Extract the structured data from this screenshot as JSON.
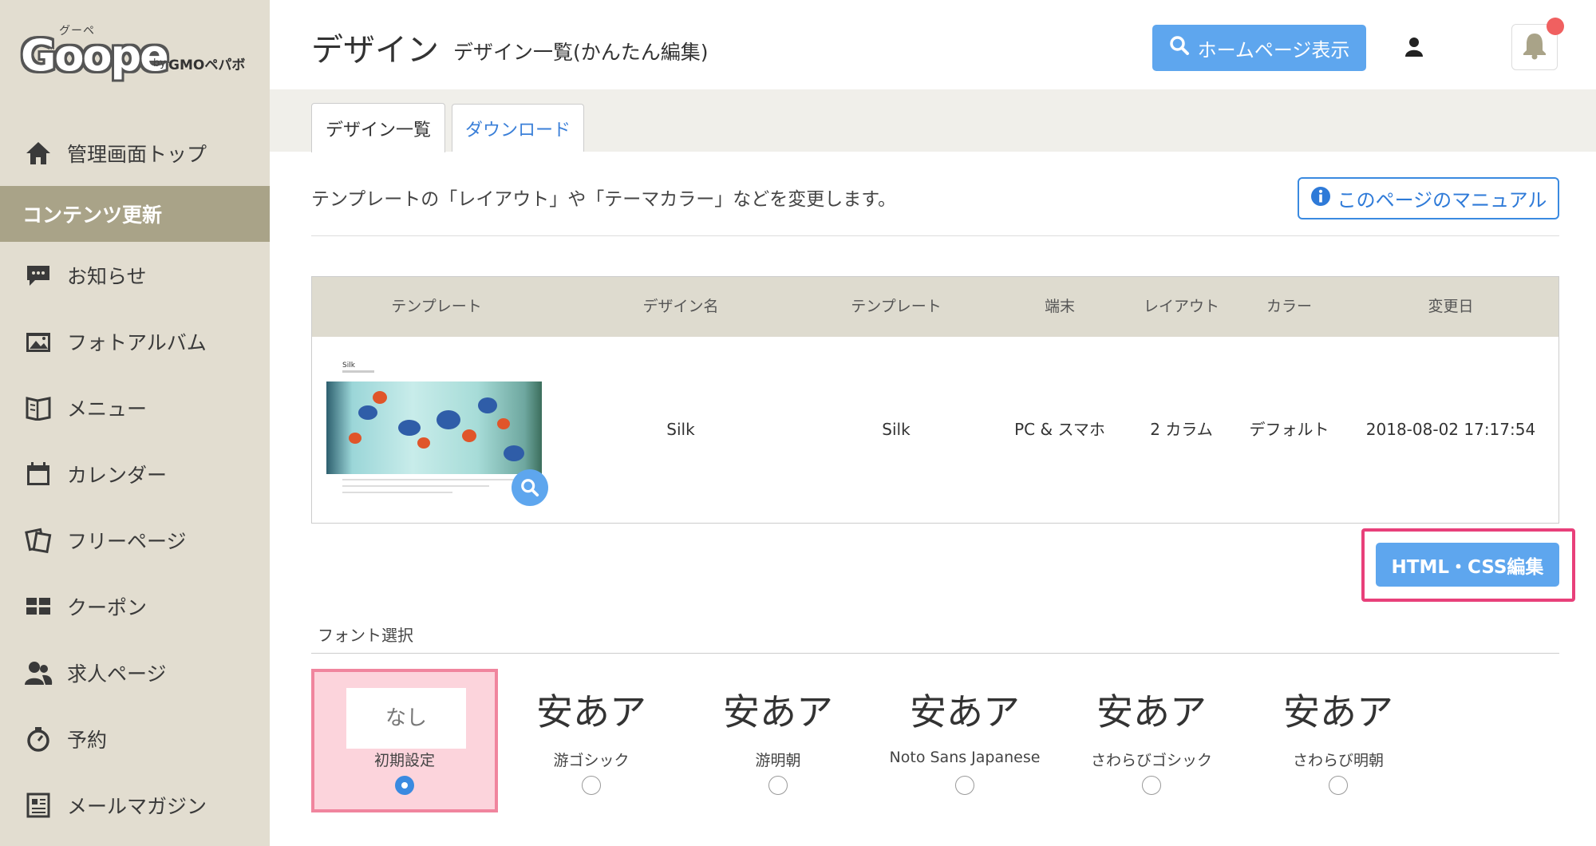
{
  "logo": {
    "top_text": "グーペ",
    "main_text": "Goope",
    "by_text": "by",
    "company_text": "GMOペパボ"
  },
  "sidebar": {
    "items": [
      {
        "label": "管理画面トップ",
        "icon": "home-icon"
      },
      {
        "label": "コンテンツ更新",
        "icon": "",
        "active": true
      },
      {
        "label": "お知らせ",
        "icon": "chat-icon"
      },
      {
        "label": "フォトアルバム",
        "icon": "photo-icon"
      },
      {
        "label": "メニュー",
        "icon": "book-icon"
      },
      {
        "label": "カレンダー",
        "icon": "calendar-icon"
      },
      {
        "label": "フリーページ",
        "icon": "pages-icon"
      },
      {
        "label": "クーポン",
        "icon": "coupon-icon"
      },
      {
        "label": "求人ページ",
        "icon": "people-icon"
      },
      {
        "label": "予約",
        "icon": "timer-icon"
      },
      {
        "label": "メールマガジン",
        "icon": "newsletter-icon"
      }
    ]
  },
  "header": {
    "title": "デザイン",
    "subtitle": "デザイン一覧(かんたん編集)",
    "home_button": "ホームページ表示"
  },
  "tabs": [
    {
      "label": "デザイン一覧",
      "active": true
    },
    {
      "label": "ダウンロード",
      "active": false
    }
  ],
  "intro": "テンプレートの「レイアウト」や「テーマカラー」などを変更します。",
  "manual_button": "このページのマニュアル",
  "table": {
    "headers": [
      "テンプレート",
      "デザイン名",
      "テンプレート",
      "端末",
      "レイアウト",
      "カラー",
      "変更日"
    ],
    "row": {
      "thumb_title": "Silk",
      "design_name": "Silk",
      "template": "Silk",
      "device": "PC & スマホ",
      "layout": "2 カラム",
      "color": "デフォルト",
      "updated": "2018-08-02 17:17:54"
    }
  },
  "edit_button": "HTML・CSS編集",
  "font_section": {
    "label": "フォント選択",
    "options": [
      {
        "sample": "なし",
        "name": "初期設定",
        "selected": true
      },
      {
        "sample": "安あア",
        "name": "游ゴシック",
        "selected": false
      },
      {
        "sample": "安あア",
        "name": "游明朝",
        "selected": false
      },
      {
        "sample": "安あア",
        "name": "Noto Sans Japanese",
        "selected": false
      },
      {
        "sample": "安あア",
        "name": "さわらびゴシック",
        "selected": false
      },
      {
        "sample": "安あア",
        "name": "さわらび明朝",
        "selected": false
      }
    ]
  },
  "colors": {
    "accent": "#5ea6ee",
    "sidebar_bg": "#e2ddd0",
    "sidebar_active": "#a9a388",
    "highlight": "#e8407a",
    "notify": "#f06060"
  }
}
